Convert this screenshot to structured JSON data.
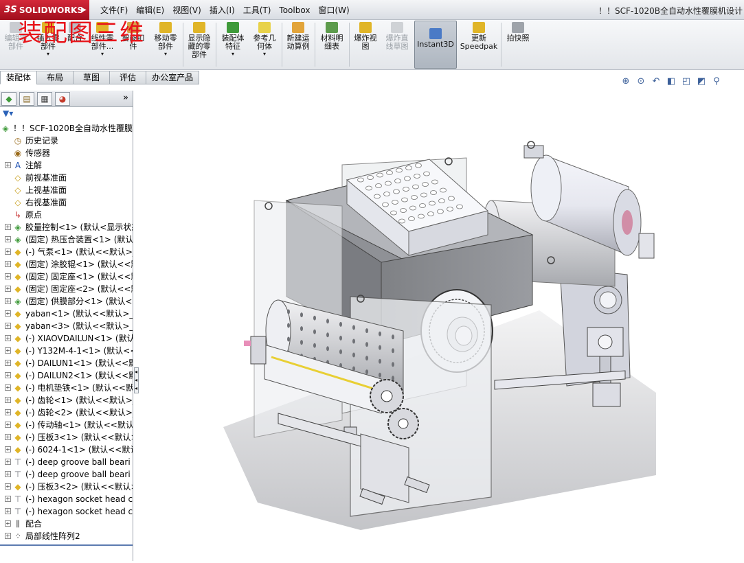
{
  "titlebar": {
    "logo_text": "SOLIDWORKS",
    "logo_prefix": "3S",
    "logo_arrow": "▶",
    "menus": [
      "文件(F)",
      "编辑(E)",
      "视图(V)",
      "插入(I)",
      "工具(T)",
      "Toolbox",
      "窗口(W)"
    ],
    "app_title": "！！SCF-1020B全自动水性覆膜机设计"
  },
  "watermark": "装配图三维",
  "toolbar": {
    "edit_component": "编辑零\n部件",
    "insert_components": "插入零\n部件",
    "mate": "配合",
    "linear_pattern": "线性零\n部件...",
    "smart_fasteners": "智能扣\n件",
    "move_component": "移动零\n部件",
    "show_hidden": "显示隐\n藏的零\n部件",
    "assembly_features": "装配体\n特征",
    "reference_geometry": "参考几\n何体",
    "new_motion_study": "新建运\n动算例",
    "bill_of_materials": "材料明\n细表",
    "exploded_view": "爆炸视\n图",
    "explode_line_sketch": "爆炸直\n线草图",
    "instant3d": "Instant3D",
    "update_speedpak": "更新\nSpeedpak",
    "take_snapshot": "拍快照",
    "caret": "▾"
  },
  "tabs": [
    "装配体",
    "布局",
    "草图",
    "评估",
    "办公室产品"
  ],
  "headsup_icons": [
    "zoom-to-fit-icon",
    "zoom-area-icon",
    "previous-view-icon",
    "section-view-icon",
    "view-orientation-icon",
    "display-style-icon",
    "hide-show-icon"
  ],
  "feature_manager": {
    "more": "»",
    "filter": "▼▾",
    "tree": [
      {
        "label": "！！SCF-1020B全自动水性覆膜机",
        "icon": "assembly-icon",
        "exp": "",
        "level": 0
      },
      {
        "label": "历史记录",
        "icon": "history-icon",
        "exp": "",
        "level": 1
      },
      {
        "label": "传感器",
        "icon": "sensor-icon",
        "exp": "",
        "level": 1
      },
      {
        "label": "注解",
        "icon": "annotation-icon",
        "exp": "+",
        "level": 1
      },
      {
        "label": "前视基准面",
        "icon": "plane-icon",
        "exp": "",
        "level": 1
      },
      {
        "label": "上视基准面",
        "icon": "plane-icon",
        "exp": "",
        "level": 1
      },
      {
        "label": "右视基准面",
        "icon": "plane-icon",
        "exp": "",
        "level": 1
      },
      {
        "label": "原点",
        "icon": "origin-icon",
        "exp": "",
        "level": 1
      },
      {
        "label": "胶量控制<1> (默认<显示状态",
        "icon": "subassembly-icon",
        "exp": "+",
        "level": 1
      },
      {
        "label": "(固定) 热压合装置<1> (默认<",
        "icon": "subassembly-icon",
        "exp": "+",
        "level": 1
      },
      {
        "label": "(-) 气泵<1> (默认<<默认>_",
        "icon": "part-icon",
        "exp": "+",
        "level": 1
      },
      {
        "label": "(固定) 涂胶辊<1> (默认<<默",
        "icon": "part-icon",
        "exp": "+",
        "level": 1
      },
      {
        "label": "(固定) 固定座<1> (默认<<默",
        "icon": "part-icon",
        "exp": "+",
        "level": 1
      },
      {
        "label": "(固定) 固定座<2> (默认<<默",
        "icon": "part-icon",
        "exp": "+",
        "level": 1
      },
      {
        "label": "(固定) 供膜部分<1> (默认<显",
        "icon": "subassembly-icon",
        "exp": "+",
        "level": 1
      },
      {
        "label": "yaban<1> (默认<<默认>_显",
        "icon": "part-icon",
        "exp": "+",
        "level": 1
      },
      {
        "label": "yaban<3> (默认<<默认>_显",
        "icon": "part-icon",
        "exp": "+",
        "level": 1
      },
      {
        "label": "(-) XIAOVDAILUN<1> (默认",
        "icon": "part-icon",
        "exp": "+",
        "level": 1
      },
      {
        "label": "(-) Y132M-4-1<1> (默认<<",
        "icon": "part-icon",
        "exp": "+",
        "level": 1
      },
      {
        "label": "(-) DAILUN1<1> (默认<<默",
        "icon": "part-icon",
        "exp": "+",
        "level": 1
      },
      {
        "label": "(-) DAILUN2<1> (默认<<默",
        "icon": "part-icon",
        "exp": "+",
        "level": 1
      },
      {
        "label": "(-) 电机垫铁<1> (默认<<默认",
        "icon": "part-icon",
        "exp": "+",
        "level": 1
      },
      {
        "label": "(-) 齿轮<1> (默认<<默认>_",
        "icon": "part-icon",
        "exp": "+",
        "level": 1
      },
      {
        "label": "(-) 齿轮<2> (默认<<默认>_",
        "icon": "part-icon",
        "exp": "+",
        "level": 1
      },
      {
        "label": "(-) 传动轴<1> (默认<<默认",
        "icon": "part-icon",
        "exp": "+",
        "level": 1
      },
      {
        "label": "(-) 压板3<1> (默认<<默认>",
        "icon": "part-icon",
        "exp": "+",
        "level": 1
      },
      {
        "label": "(-) 6024-1<1> (默认<<默认",
        "icon": "part-icon",
        "exp": "+",
        "level": 1
      },
      {
        "label": "(-) deep groove ball beari",
        "icon": "toolbox-part-icon",
        "exp": "+",
        "level": 1
      },
      {
        "label": "(-) deep groove ball beari",
        "icon": "toolbox-part-icon",
        "exp": "+",
        "level": 1
      },
      {
        "label": "(-) 压板3<2> (默认<<默认>",
        "icon": "part-icon",
        "exp": "+",
        "level": 1
      },
      {
        "label": "(-) hexagon socket head c",
        "icon": "toolbox-part-icon",
        "exp": "+",
        "level": 1
      },
      {
        "label": "(-) hexagon socket head c",
        "icon": "toolbox-part-icon",
        "exp": "+",
        "level": 1
      },
      {
        "label": "配合",
        "icon": "mates-icon",
        "exp": "+",
        "level": 1
      },
      {
        "label": "局部线性阵列2",
        "icon": "pattern-icon",
        "exp": "+",
        "level": 1
      }
    ]
  },
  "colors": {
    "logo_red": "#c41a2b",
    "watermark_red": "#e8141a",
    "part_yellow": "#e0b528",
    "assembly_green": "#3f9a3a",
    "machine_gray": "#8a8d92",
    "machine_light": "#e4e6ec"
  }
}
